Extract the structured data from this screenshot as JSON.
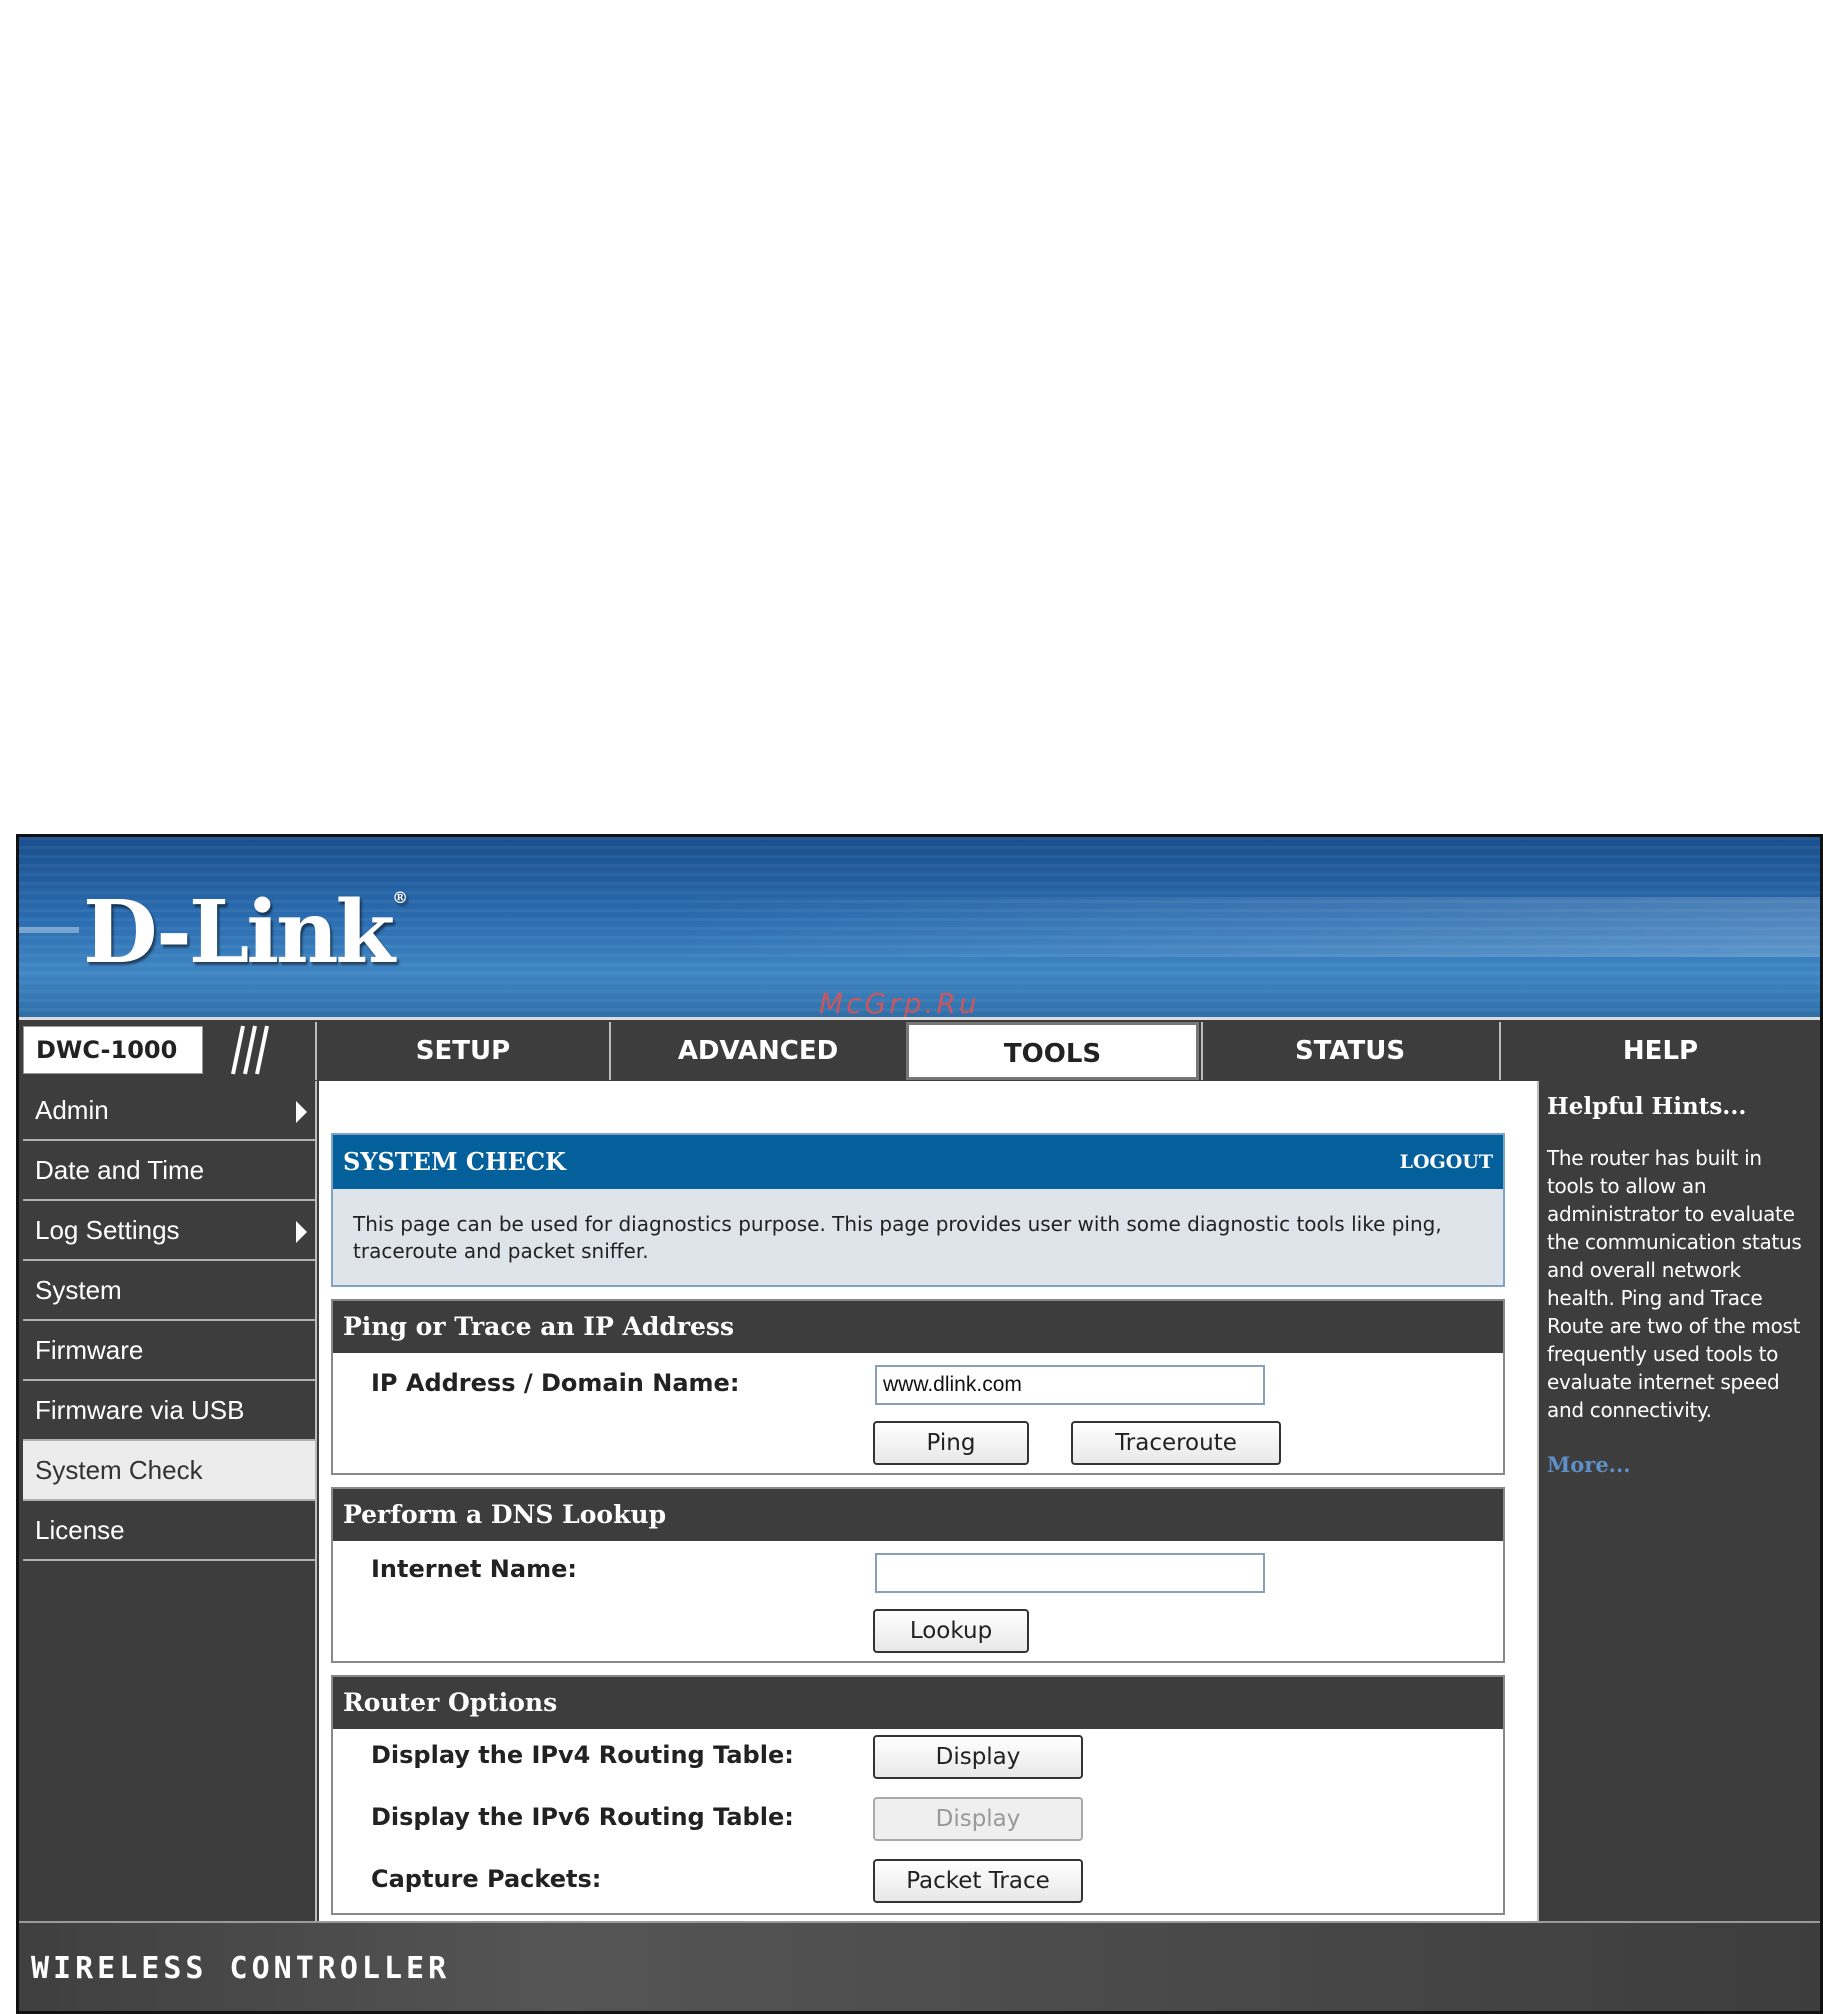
{
  "brand": {
    "logo": "D-Link",
    "registered": "®"
  },
  "watermark": "McGrp.Ru",
  "model": "DWC-1000",
  "tabs": [
    {
      "label": "SETUP"
    },
    {
      "label": "ADVANCED"
    },
    {
      "label": "TOOLS",
      "active": true
    },
    {
      "label": "STATUS"
    },
    {
      "label": "HELP"
    }
  ],
  "sidebar": {
    "items": [
      {
        "label": "Admin",
        "has_submenu": true
      },
      {
        "label": "Date and Time"
      },
      {
        "label": "Log Settings",
        "has_submenu": true
      },
      {
        "label": "System"
      },
      {
        "label": "Firmware"
      },
      {
        "label": "Firmware via USB"
      },
      {
        "label": "System Check",
        "active": true
      },
      {
        "label": "License"
      }
    ]
  },
  "system_check": {
    "title": "SYSTEM CHECK",
    "logout": "LOGOUT",
    "description": "This page can be used for diagnostics purpose. This page provides user with some diagnostic tools like ping, traceroute and packet sniffer."
  },
  "ping": {
    "header": "Ping or Trace an IP Address",
    "label": "IP Address / Domain Name:",
    "value": "www.dlink.com",
    "ping_button": "Ping",
    "traceroute_button": "Traceroute"
  },
  "dns": {
    "header": "Perform a DNS Lookup",
    "label": "Internet Name:",
    "value": "",
    "lookup_button": "Lookup"
  },
  "router_options": {
    "header": "Router Options",
    "ipv4_label": "Display the IPv4 Routing Table:",
    "ipv4_button": "Display",
    "ipv6_label": "Display the IPv6 Routing Table:",
    "ipv6_button": "Display",
    "capture_label": "Capture Packets:",
    "capture_button": "Packet Trace"
  },
  "hints": {
    "title": "Helpful Hints...",
    "text": "The router has built in tools to allow an administrator to evaluate the communication status and overall network health. Ping and Trace Route are two of the most frequently used tools to evaluate internet speed and connectivity.",
    "more": "More..."
  },
  "footer": "WIRELESS CONTROLLER",
  "colors": {
    "banner": "#2a6cb0",
    "panel_header": "#04609b",
    "dark": "#3d3d3d",
    "link": "#5e8fc6"
  }
}
